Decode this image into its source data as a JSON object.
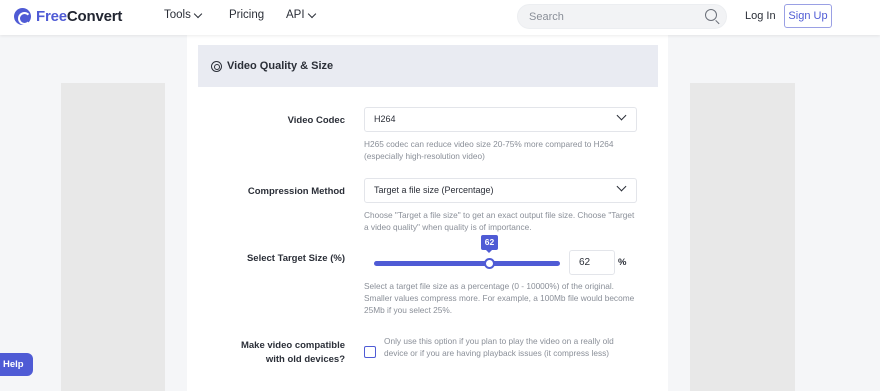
{
  "brand": {
    "part1": "Free",
    "part2": "Convert"
  },
  "nav": {
    "tools": "Tools",
    "pricing": "Pricing",
    "api": "API",
    "search_placeholder": "Search",
    "login": "Log In",
    "signup": "Sign Up"
  },
  "section": {
    "title": "Video Quality & Size"
  },
  "fields": {
    "codec": {
      "label": "Video Codec",
      "value": "H264",
      "help": "H265 codec can reduce video size 20-75% more compared to H264 (especially high-resolution video)"
    },
    "compression": {
      "label": "Compression Method",
      "value": "Target a file size (Percentage)",
      "help": "Choose \"Target a file size\" to get an exact output file size. Choose \"Target a video quality\" when quality is of importance."
    },
    "target_size": {
      "label": "Select Target Size (%)",
      "value": "62",
      "bubble": "62",
      "unit": "%",
      "help": "Select a target file size as a percentage (0 - 10000%) of the original. Smaller values compress more. For example, a 100Mb file would become 25Mb if you select 25%."
    },
    "compat": {
      "label_line1": "Make video compatible",
      "label_line2": "with old devices?",
      "checked": false,
      "help": "Only use this option if you plan to play the video on a really old device or if you are having playback issues (it compress less)"
    }
  },
  "help_button": "Help",
  "colors": {
    "accent": "#4f5bd5",
    "header_bg": "#e9ebf2",
    "muted_text": "#8a8f98"
  }
}
